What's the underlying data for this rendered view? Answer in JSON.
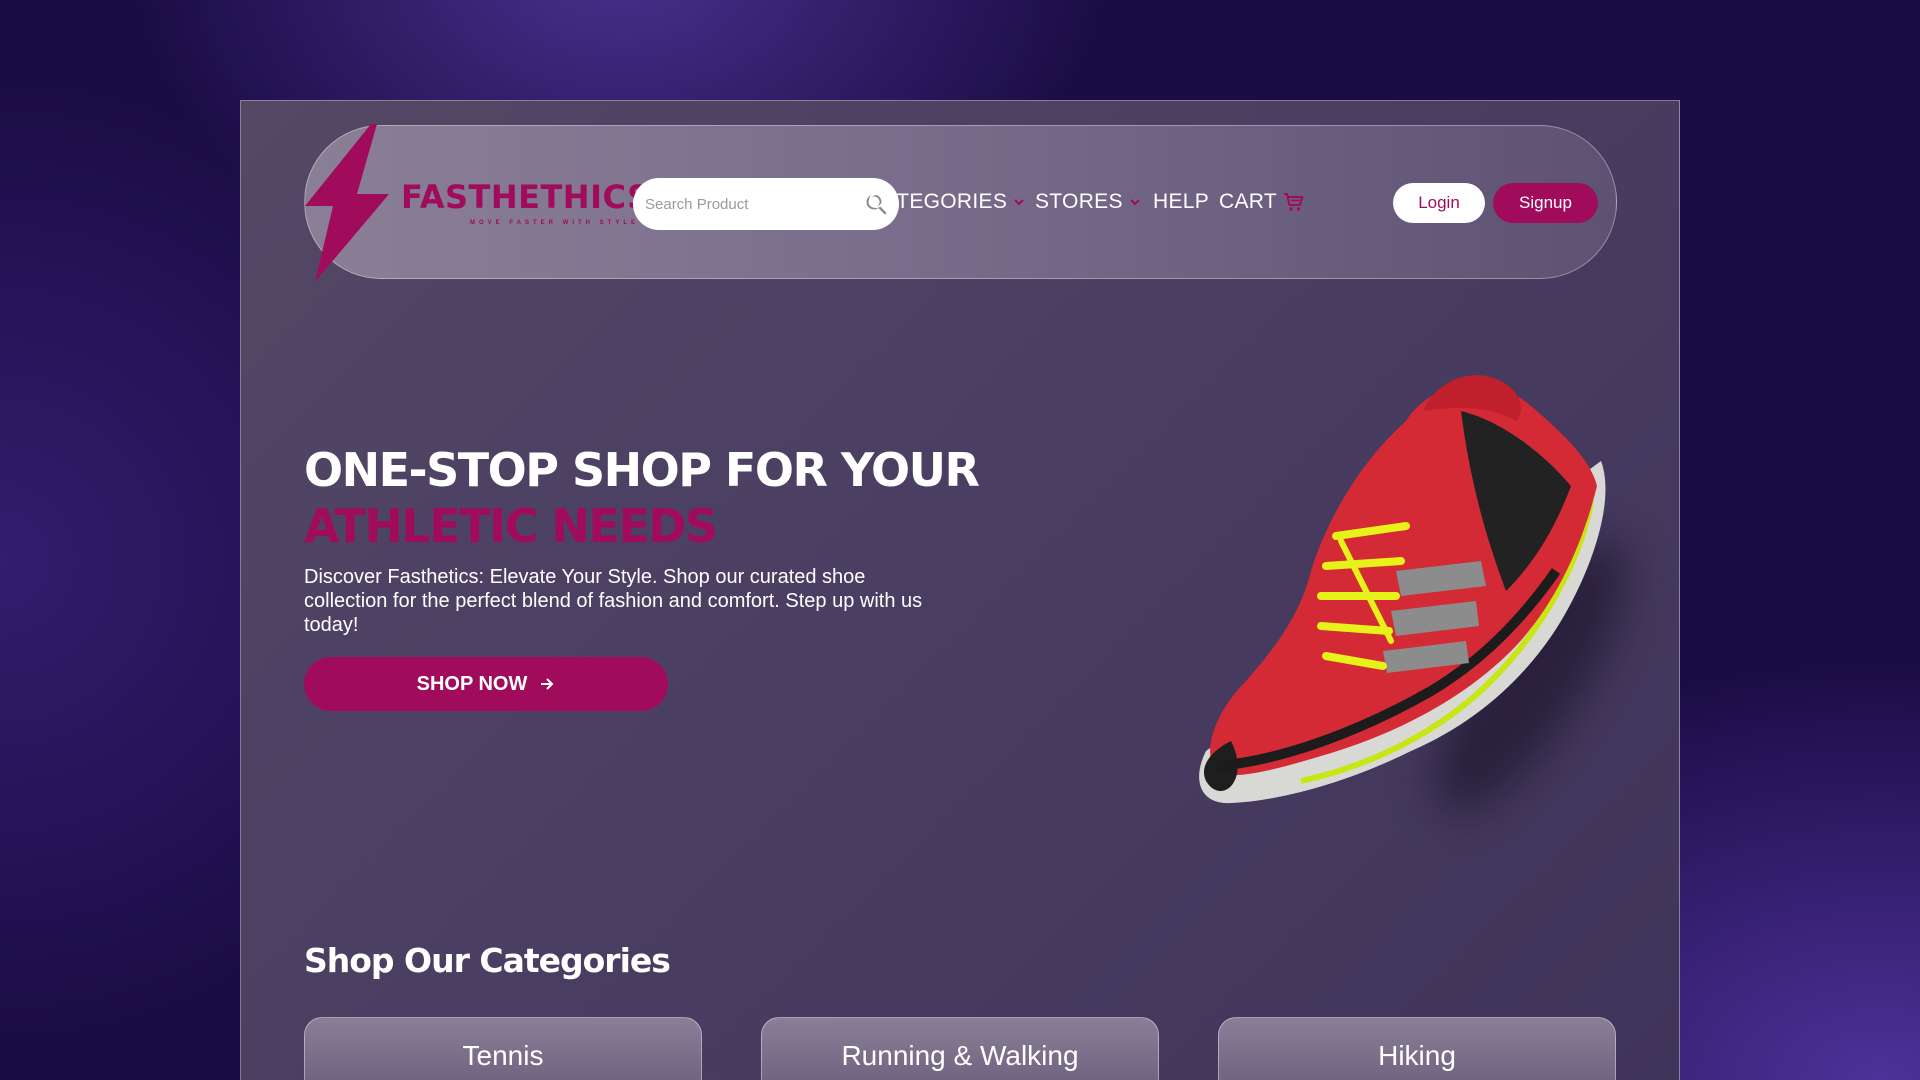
{
  "brand": {
    "name": "FASTHETHICS",
    "tagline": "MOVE FASTER WITH STYLE",
    "accent_color": "#a00b5c"
  },
  "search": {
    "placeholder": "Search Product",
    "icon": "search-icon"
  },
  "nav": {
    "categories": "CATEGORIES",
    "stores": "STORES",
    "help": "HELP",
    "cart": "CART"
  },
  "auth": {
    "login": "Login",
    "signup": "Signup"
  },
  "hero": {
    "title_line1": "ONE-STOP SHOP FOR YOUR",
    "title_line2": "ATHLETIC NEEDS",
    "description": "Discover Fasthetics: Elevate Your Style. Shop our curated shoe collection for the perfect blend of fashion and comfort. Step up with us today!",
    "cta": "SHOP NOW"
  },
  "categories_section": {
    "title": "Shop Our Categories",
    "items": [
      "Tennis",
      "Running & Walking",
      "Hiking"
    ]
  }
}
